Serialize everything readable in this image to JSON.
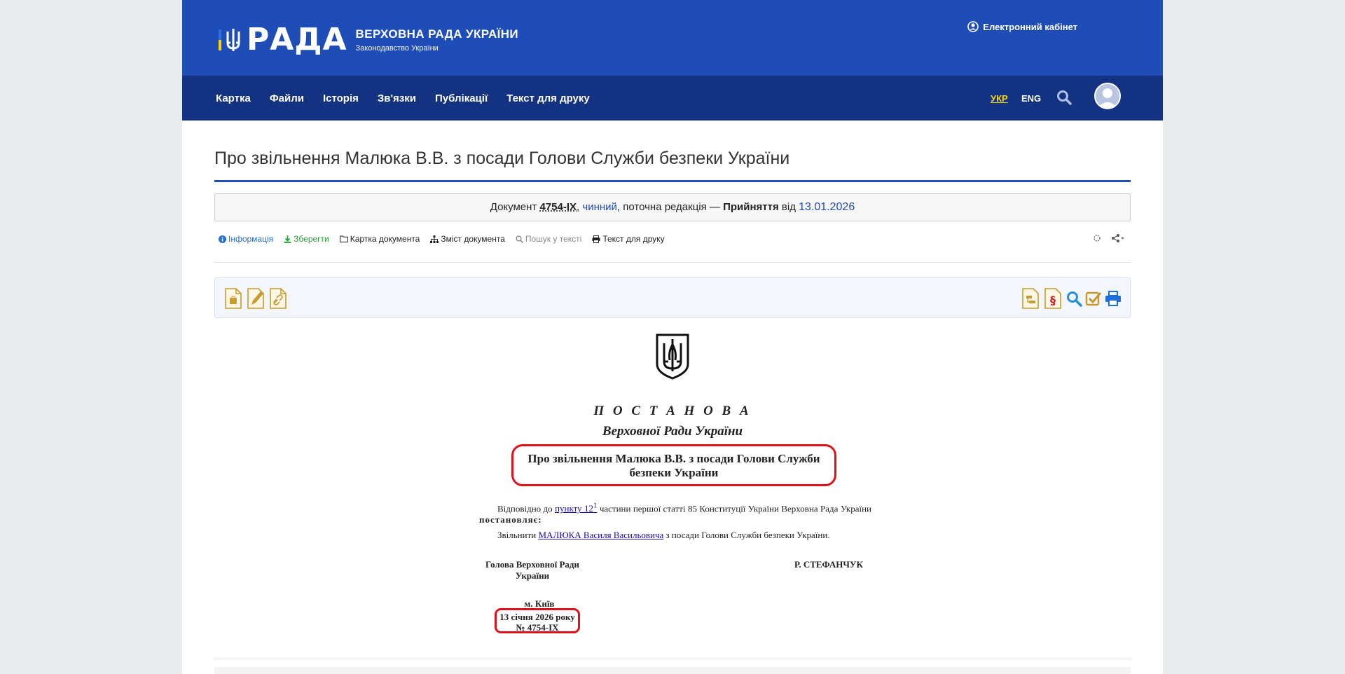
{
  "header": {
    "logo_word": "РАДА",
    "logo_line1": "ВЕРХОВНА РАДА УКРАЇНИ",
    "logo_line2": "Законодавство України",
    "cabinet": "Електронний кабінет",
    "brand_blue": "#1e4db7",
    "nav_blue": "#133282"
  },
  "nav": {
    "items": [
      "Картка",
      "Файли",
      "Історія",
      "Зв'язки",
      "Публікації",
      "Текст для друку"
    ],
    "lang_ua": "УКР",
    "lang_en": "ENG"
  },
  "doc_header": {
    "title": "Про звільнення Малюка В.В. з посади Голови Служби безпеки України",
    "status_prefix": "Документ ",
    "number": "4754-IX",
    "sep1": ", ",
    "state": "чинний",
    "mid": ", поточна редакція — ",
    "adopted": "Прийняття",
    "from": " від ",
    "date": "13.01.2026"
  },
  "tools": {
    "info": "Інформація",
    "save": "Зберегти",
    "card": "Картка документа",
    "contents": "Зміст документа",
    "search": "Пошук у тексті",
    "print": "Текст для друку"
  },
  "document": {
    "postanova": "П О С Т А Н О В А",
    "verkhovna": "Верховної Ради України",
    "title": "Про звільнення Малюка В.В. з посади Голови Служби безпеки України",
    "p1_a": "Відповідно до ",
    "p1_link": "пункту 12",
    "p1_sup": "1",
    "p1_b": " частини першої статті 85 Конституції України Верховна Рада України ",
    "p1_bold": "постановляє:",
    "p2_a": "Звільнити ",
    "p2_link": "МАЛЮКА Василя Васильовича",
    "p2_b": " з посади Голови Служби безпеки України.",
    "sign_left": "Голова Верховної Ради України",
    "sign_right": "Р. СТЕФАНЧУК",
    "place": "м. Київ",
    "date_line": "13 січня 2026 року",
    "number_line": "№ 4754-IX",
    "highlight_color": "#e0101a"
  }
}
